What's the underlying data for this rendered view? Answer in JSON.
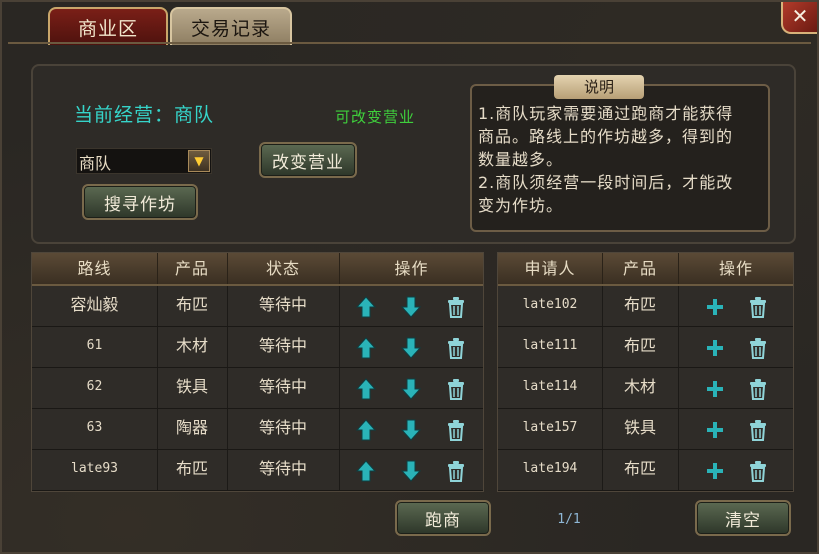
{
  "tabs": [
    {
      "label": "商业区",
      "active": true
    },
    {
      "label": "交易记录",
      "active": false
    }
  ],
  "close_icon": "close-icon",
  "info": {
    "current_business": "当前经营：商队",
    "can_change": "可改变营业",
    "select_value": "商队",
    "change_button": "改变营业",
    "search_button": "搜寻作坊"
  },
  "description": {
    "title": "说明",
    "lines": [
      "1.商队玩家需要通过跑商才能获得",
      "商品。路线上的作坊越多，得到的",
      "数量越多。",
      "2.商队须经营一段时间后，才能改",
      "变为作坊。"
    ]
  },
  "route_table": {
    "headers": [
      "路线",
      "产品",
      "状态",
      "操作"
    ],
    "rows": [
      {
        "route": "容灿毅",
        "product": "布匹",
        "status": "等待中"
      },
      {
        "route": "61",
        "product": "木材",
        "status": "等待中"
      },
      {
        "route": "62",
        "product": "铁具",
        "status": "等待中"
      },
      {
        "route": "63",
        "product": "陶器",
        "status": "等待中"
      },
      {
        "route": "late93",
        "product": "布匹",
        "status": "等待中"
      }
    ],
    "row_ops": [
      "move-up-icon",
      "move-down-icon",
      "delete-icon"
    ]
  },
  "applicant_table": {
    "headers": [
      "申请人",
      "产品",
      "操作"
    ],
    "rows": [
      {
        "applicant": "late102",
        "product": "布匹"
      },
      {
        "applicant": "late111",
        "product": "布匹"
      },
      {
        "applicant": "late114",
        "product": "木材"
      },
      {
        "applicant": "late157",
        "product": "铁具"
      },
      {
        "applicant": "late194",
        "product": "布匹"
      }
    ],
    "row_ops": [
      "add-icon",
      "delete-icon"
    ]
  },
  "footer": {
    "run_button": "跑商",
    "page": "1/1",
    "clear_button": "清空"
  },
  "colors": {
    "accent_cyan": "#36d4c9",
    "accent_green": "#3fcf3c",
    "icon_teal": "#2ab3b8"
  }
}
